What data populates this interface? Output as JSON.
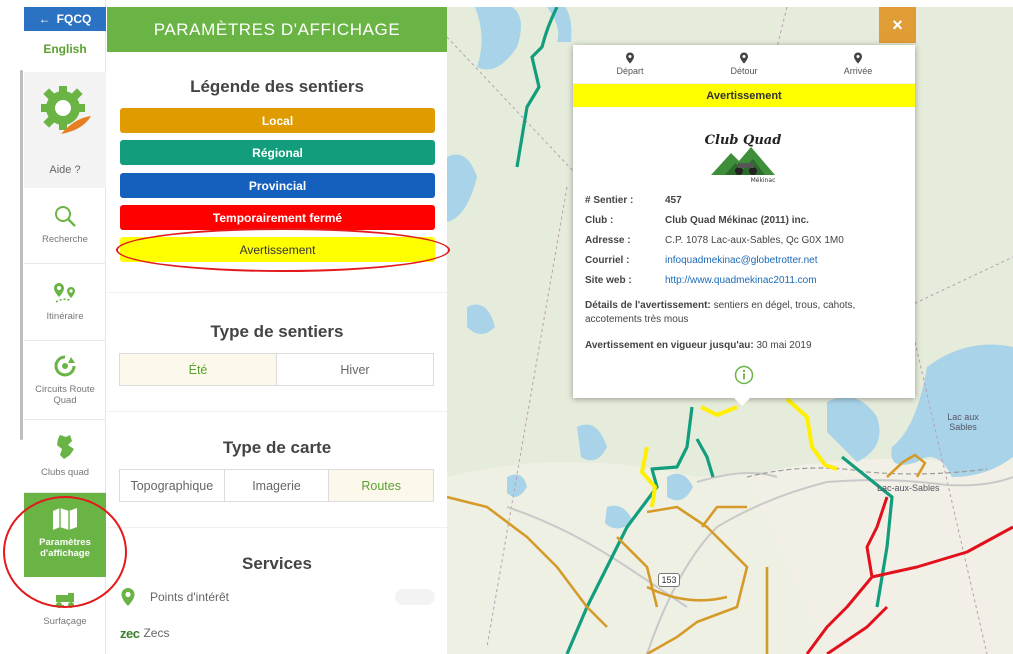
{
  "rail": {
    "back_label": "FQCQ",
    "language": "English",
    "help": "Aide ?",
    "items": [
      {
        "label": "Recherche"
      },
      {
        "label": "Itinéraire"
      },
      {
        "label": "Circuits Route Quad"
      },
      {
        "label": "Clubs quad"
      },
      {
        "label": "Paramètres d'affichage"
      },
      {
        "label": "Surfaçage"
      }
    ]
  },
  "panel": {
    "title": "PARAMÈTRES D'AFFICHAGE",
    "legend_title": "Légende des sentiers",
    "legend": [
      {
        "label": "Local",
        "color": "#e09b00"
      },
      {
        "label": "Régional",
        "color": "#129e7d"
      },
      {
        "label": "Provincial",
        "color": "#1560bd"
      },
      {
        "label": "Temporairement fermé",
        "color": "#ff0000"
      },
      {
        "label": "Avertissement",
        "color": "#ffff00"
      }
    ],
    "trail_type_title": "Type de sentiers",
    "trail_types": [
      "Été",
      "Hiver"
    ],
    "map_type_title": "Type de carte",
    "map_types": [
      "Topographique",
      "Imagerie",
      "Routes"
    ],
    "services_title": "Services",
    "services": [
      {
        "label": "Points d'intérêt"
      },
      {
        "label": "Zecs",
        "badge": "zec"
      }
    ]
  },
  "map": {
    "route_number": "153",
    "place_label": "Lac-aux-Sables",
    "lake_label": "Lac aux Sables",
    "close_icon": "×",
    "popup": {
      "actions": [
        "Départ",
        "Détour",
        "Arrivée"
      ],
      "banner": "Avertissement",
      "logo_text": "Club Quad",
      "logo_sub": "Mékinac",
      "fields": [
        {
          "key": "# Sentier :",
          "value": "457"
        },
        {
          "key": "Club :",
          "value": "Club Quad Mékinac (2011) inc."
        },
        {
          "key": "Adresse :",
          "value": "C.P. 1078 Lac-aux-Sables, Qc G0X 1M0"
        },
        {
          "key": "Courriel :",
          "value": "infoquadmekinac@globetrotter.net"
        },
        {
          "key": "Site web :",
          "value": "http://www.quadmekinac2011.com"
        }
      ],
      "details_label": "Détails de l'avertissement:",
      "details_text": "sentiers en dégel, trous, cahots, accotements très mous",
      "valid_label": "Avertissement en vigueur jusqu'au:",
      "valid_date": "30 mai 2019"
    }
  }
}
